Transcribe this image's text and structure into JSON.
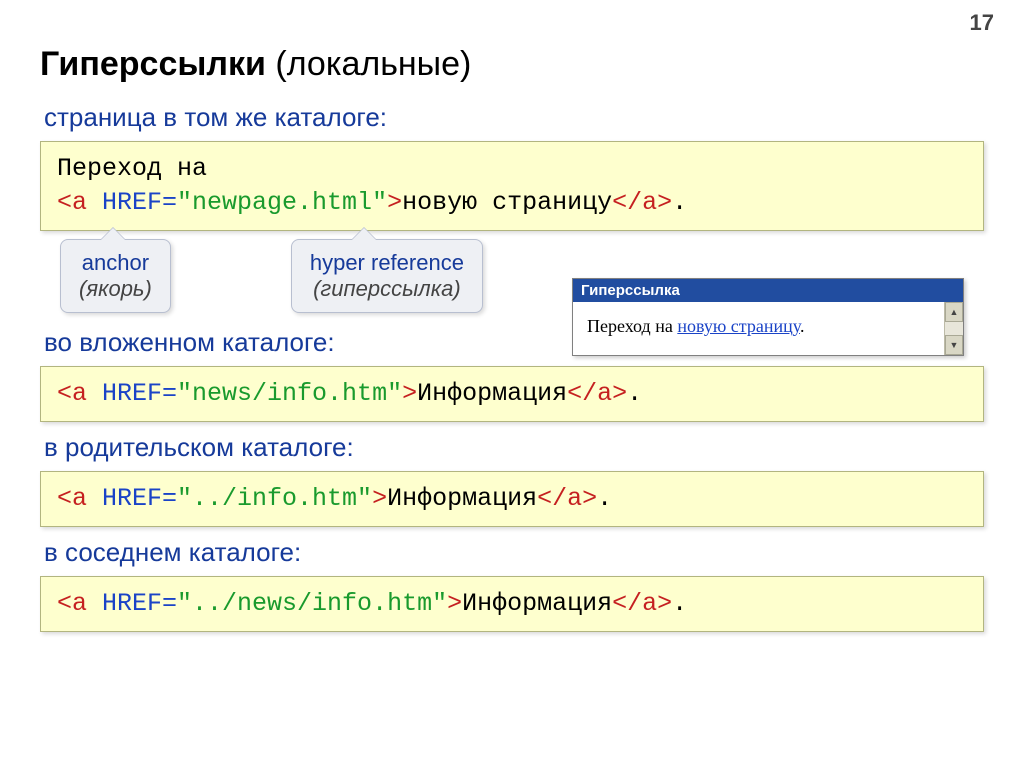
{
  "page_number": "17",
  "title_bold": "Гиперссылки",
  "title_rest": " (локальные)",
  "h1": "страница в том же каталоге:",
  "code1": {
    "line1": "Переход на",
    "tag_open": "<a",
    "href_attr": " HREF=",
    "href_val": "\"newpage.html\"",
    "close": ">",
    "text": "новую страницу",
    "tag_close": "</a>",
    "dot": "."
  },
  "callout1_main": "anchor",
  "callout1_sub": "(якорь)",
  "callout2_main": "hyper reference",
  "callout2_sub": "(гиперссылка)",
  "browser_title": "Гиперссылка",
  "browser_text_prefix": "Переход на ",
  "browser_link": "новую страницу",
  "browser_text_suffix": ".",
  "h2": "во вложенном каталоге:",
  "code2": {
    "tag_open": "<a",
    "href_attr": " HREF=",
    "href_val": "\"news/info.htm\"",
    "close": ">",
    "text": "Информация",
    "tag_close": "</a>",
    "dot": "."
  },
  "h3": "в родительском каталоге:",
  "code3": {
    "tag_open": "<a",
    "href_attr": " HREF=",
    "href_val": "\"../info.htm\"",
    "close": ">",
    "text": "Информация",
    "tag_close": "</a>",
    "dot": "."
  },
  "h4": "в соседнем каталоге:",
  "code4": {
    "tag_open": "<a",
    "href_attr": " HREF=",
    "href_val": "\"../news/info.htm\"",
    "close": ">",
    "text": "Информация",
    "tag_close": "</a>",
    "dot": "."
  }
}
